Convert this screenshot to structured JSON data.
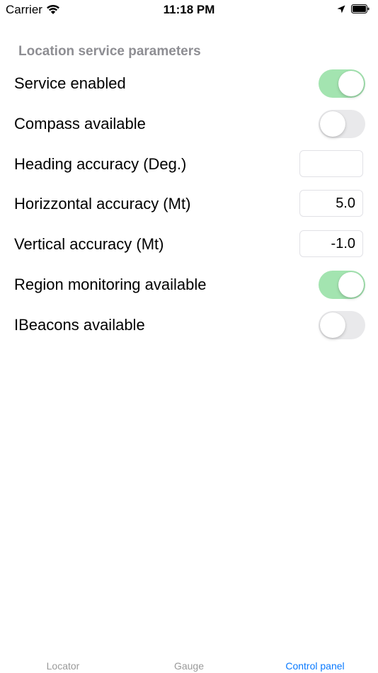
{
  "status_bar": {
    "carrier": "Carrier",
    "time": "11:18 PM"
  },
  "section": {
    "title": "Location service parameters"
  },
  "rows": [
    {
      "label": "Service enabled",
      "control": "toggle",
      "on": true
    },
    {
      "label": "Compass available",
      "control": "toggle",
      "on": false
    },
    {
      "label": "Heading accuracy (Deg.)",
      "control": "field",
      "value": ""
    },
    {
      "label": "Horizzontal accuracy (Mt)",
      "control": "field",
      "value": "5.0"
    },
    {
      "label": "Vertical accuracy (Mt)",
      "control": "field",
      "value": "-1.0"
    },
    {
      "label": "Region monitoring available",
      "control": "toggle",
      "on": true
    },
    {
      "label": "IBeacons available",
      "control": "toggle",
      "on": false
    }
  ],
  "tabs": [
    {
      "label": "Locator",
      "active": false
    },
    {
      "label": "Gauge",
      "active": false
    },
    {
      "label": "Control panel",
      "active": true
    }
  ],
  "colors": {
    "toggle_on": "#a3e4b0",
    "toggle_off": "#e9e9eb",
    "tab_active": "#0a7aff",
    "tab_inactive": "#9a9a9a",
    "section_header": "#8e8e93"
  }
}
